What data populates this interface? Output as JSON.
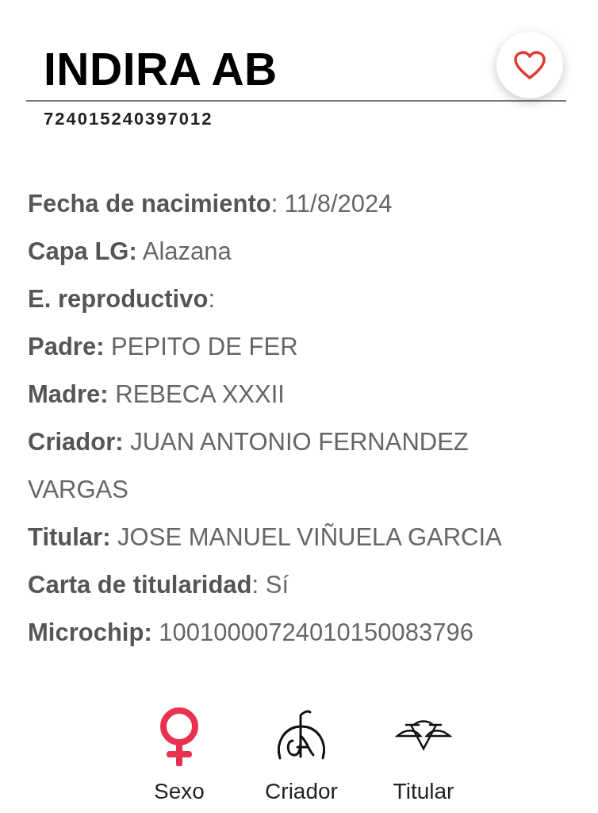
{
  "header": {
    "title": "INDIRA AB",
    "code": "724015240397012",
    "favorite": false
  },
  "fields": [
    {
      "text": "**Fecha de nacimiento**: 11/8/2024"
    },
    {
      "text": "**Capa LG:** Alazana"
    },
    {
      "text": "**E. reproductivo**:"
    },
    {
      "text": "**Padre:** PEPITO DE FER"
    },
    {
      "text": "**Madre:** REBECA XXXII"
    },
    {
      "text": "**Criador:** JUAN ANTONIO FERNANDEZ VARGAS"
    },
    {
      "text": "**Titular:** JOSE MANUEL VIÑUELA GARCIA"
    },
    {
      "text": "**Carta de titularidad**: Sí"
    },
    {
      "text": "**Microchip:** 10010000724010150083796"
    }
  ],
  "badges": [
    {
      "kind": "sex",
      "label": "Sexo"
    },
    {
      "kind": "breeder",
      "label": "Criador"
    },
    {
      "kind": "owner",
      "label": "Titular"
    }
  ]
}
